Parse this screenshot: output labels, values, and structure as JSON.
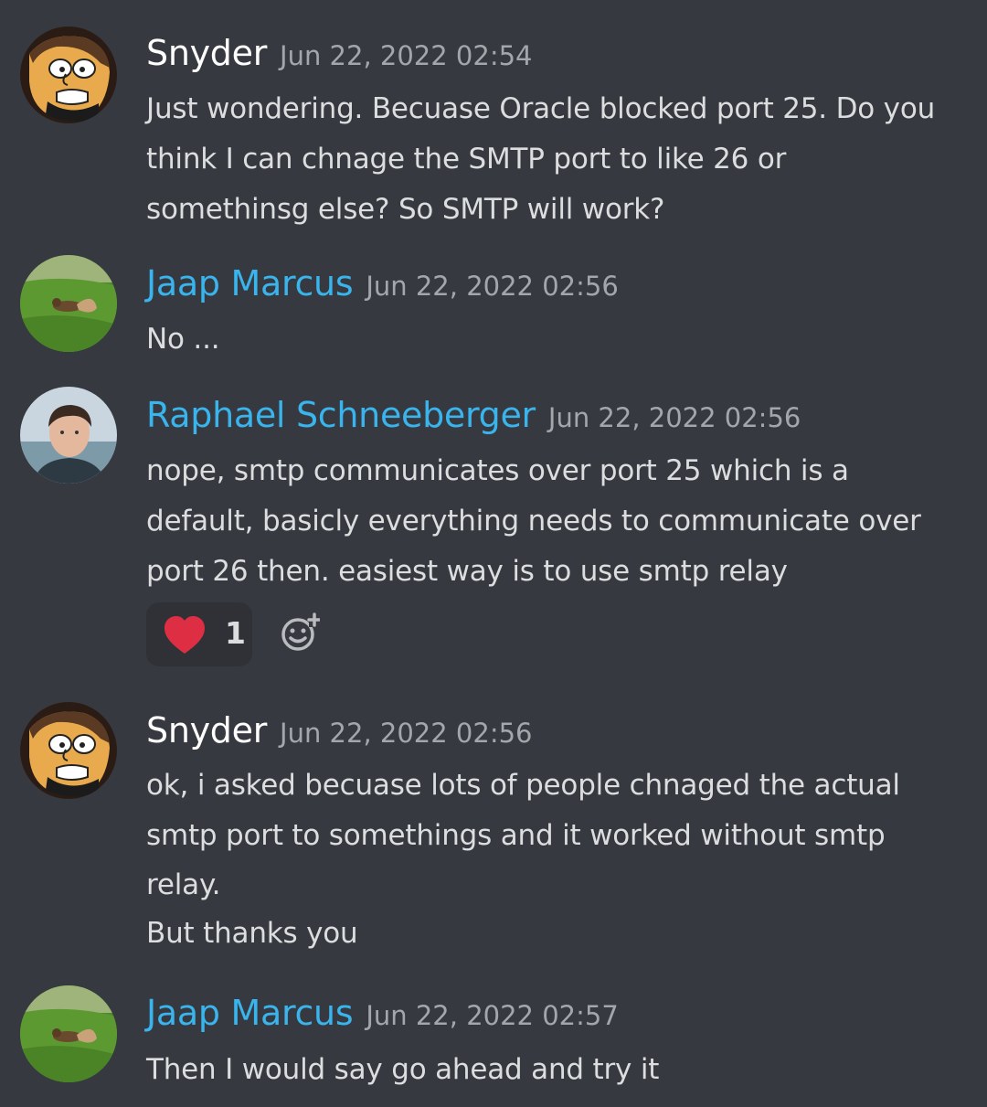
{
  "messages": [
    {
      "author": "Snyder",
      "author_color": "#ffffff",
      "timestamp": "Jun 22, 2022 02:54",
      "avatar": "cartoon-man-avatar",
      "lines": [
        "Just wondering. Becuase Oracle blocked port 25. Do you",
        "think I can chnage the SMTP port to like 26 or",
        "somethinsg else? So SMTP will work?"
      ]
    },
    {
      "author": "Jaap Marcus",
      "author_color": "#3ab4ec",
      "timestamp": "Jun 22, 2022 02:56",
      "avatar": "squirrel-on-grass-avatar",
      "lines": [
        "No ..."
      ]
    },
    {
      "author": "Raphael Schneeberger",
      "author_color": "#3ab4ec",
      "timestamp": "Jun 22, 2022 02:56",
      "avatar": "young-man-photo-avatar",
      "lines": [
        "nope, smtp communicates over port 25 which is a",
        "default, basicly everything needs to communicate over",
        "port 26 then. easiest way is to use smtp relay"
      ],
      "reactions": [
        {
          "emoji": "red-heart-icon",
          "count": "1"
        }
      ]
    },
    {
      "author": "Snyder",
      "author_color": "#ffffff",
      "timestamp": "Jun 22, 2022 02:56",
      "avatar": "cartoon-man-avatar",
      "lines": [
        "ok, i asked becuase lots of people chnaged the actual",
        "smtp port to somethings and it worked without smtp",
        "relay.",
        "But thanks you"
      ]
    },
    {
      "author": "Jaap Marcus",
      "author_color": "#3ab4ec",
      "timestamp": "Jun 22, 2022 02:57",
      "avatar": "squirrel-on-grass-avatar",
      "lines": [
        "Then I would say go ahead and try it"
      ]
    }
  ],
  "colors": {
    "background": "#36393f",
    "text": "#dcddde",
    "timestamp": "#a3a6aa",
    "reaction_bg": "#2f3136",
    "heart": "#dd2e44"
  }
}
